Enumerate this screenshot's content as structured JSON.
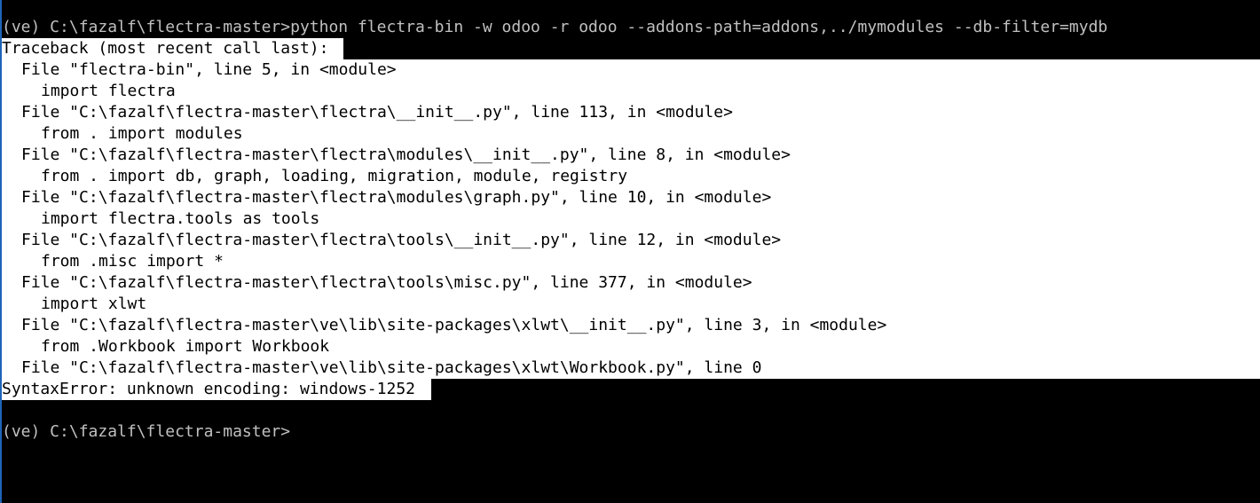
{
  "console": {
    "command_line": "(ve) C:\\fazalf\\flectra-master>python flectra-bin -w odoo -r odoo --addons-path=addons,../mymodules --db-filter=mydb",
    "traceback_header": "Traceback (most recent call last):",
    "traceback": [
      {
        "file": "File \"flectra-bin\", line 5, in <module>",
        "code": "import flectra"
      },
      {
        "file": "File \"C:\\fazalf\\flectra-master\\flectra\\__init__.py\", line 113, in <module>",
        "code": "from . import modules"
      },
      {
        "file": "File \"C:\\fazalf\\flectra-master\\flectra\\modules\\__init__.py\", line 8, in <module>",
        "code": "from . import db, graph, loading, migration, module, registry"
      },
      {
        "file": "File \"C:\\fazalf\\flectra-master\\flectra\\modules\\graph.py\", line 10, in <module>",
        "code": "import flectra.tools as tools"
      },
      {
        "file": "File \"C:\\fazalf\\flectra-master\\flectra\\tools\\__init__.py\", line 12, in <module>",
        "code": "from .misc import *"
      },
      {
        "file": "File \"C:\\fazalf\\flectra-master\\flectra\\tools\\misc.py\", line 377, in <module>",
        "code": "import xlwt"
      },
      {
        "file": "File \"C:\\fazalf\\flectra-master\\ve\\lib\\site-packages\\xlwt\\__init__.py\", line 3, in <module>",
        "code": "from .Workbook import Workbook"
      }
    ],
    "last_file_line": "File \"C:\\fazalf\\flectra-master\\ve\\lib\\site-packages\\xlwt\\Workbook.py\", line 0",
    "error_line": "SyntaxError: unknown encoding: windows-1252",
    "prompt": "(ve) C:\\fazalf\\flectra-master>"
  }
}
